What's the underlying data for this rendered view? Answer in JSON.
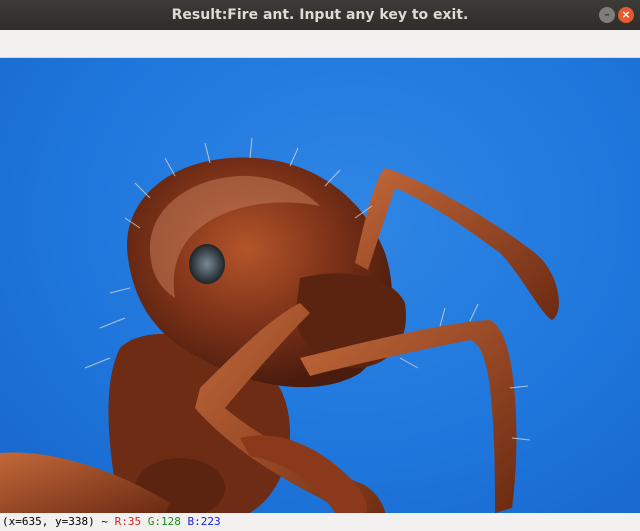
{
  "window": {
    "title": "Result:Fire ant. Input any key to exit.",
    "minimize_glyph": "–",
    "close_glyph": "×"
  },
  "status": {
    "coords": "(x=635, y=338) ~ ",
    "r": "R:35",
    "g": "G:128",
    "b": "B:223"
  },
  "colors": {
    "background_blue": "#1f77dd",
    "ant_body": "#8a3a1a",
    "close_button": "#e75a2d"
  }
}
